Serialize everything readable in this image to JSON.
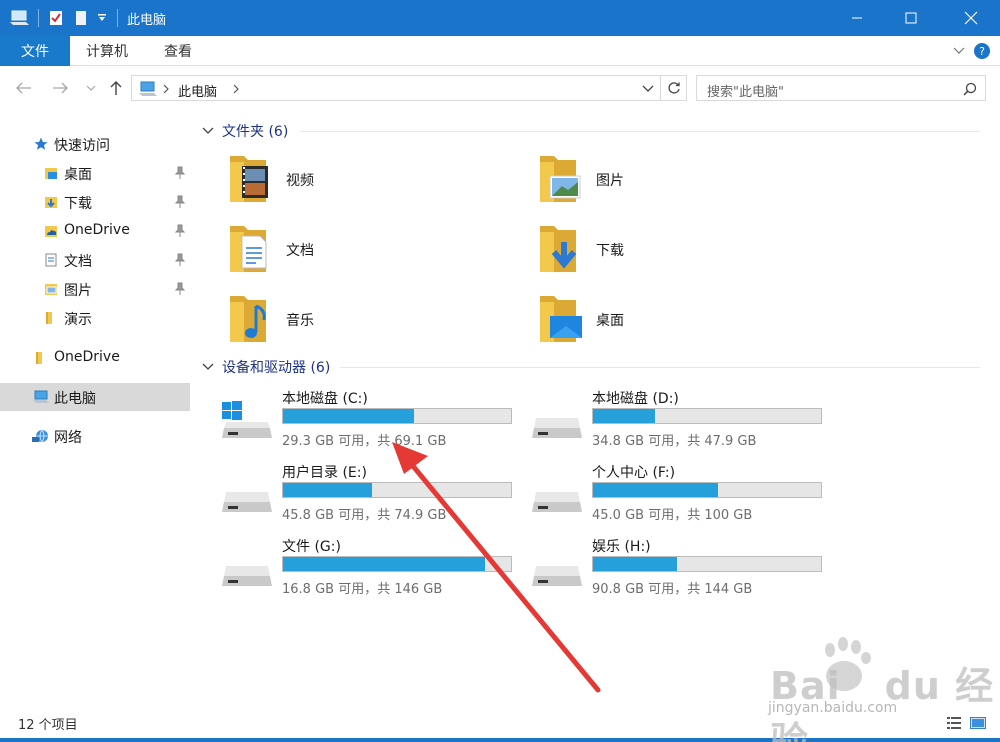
{
  "window": {
    "title": "此电脑"
  },
  "ribbon": {
    "tabs": [
      "文件",
      "计算机",
      "查看"
    ]
  },
  "address": {
    "location": "此电脑",
    "search_placeholder": "搜索\"此电脑\""
  },
  "sidebar": {
    "items": [
      {
        "label": "快速访问",
        "pinned": false,
        "icon": "star-icon"
      },
      {
        "label": "桌面",
        "pinned": true,
        "icon": "desktop-folder-icon"
      },
      {
        "label": "下载",
        "pinned": true,
        "icon": "download-folder-icon"
      },
      {
        "label": "OneDrive",
        "pinned": true,
        "icon": "onedrive-folder-icon"
      },
      {
        "label": "文档",
        "pinned": true,
        "icon": "documents-folder-icon"
      },
      {
        "label": "图片",
        "pinned": true,
        "icon": "pictures-folder-icon"
      },
      {
        "label": "演示",
        "pinned": false,
        "icon": "folder-icon"
      },
      {
        "label": "OneDrive",
        "pinned": false,
        "icon": "onedrive-icon"
      },
      {
        "label": "此电脑",
        "pinned": false,
        "icon": "computer-icon",
        "selected": true
      },
      {
        "label": "网络",
        "pinned": false,
        "icon": "network-icon"
      }
    ]
  },
  "folders": {
    "header": "文件夹 (6)",
    "items": [
      {
        "label": "视频",
        "icon": "videos-folder-icon"
      },
      {
        "label": "图片",
        "icon": "pictures-folder-icon"
      },
      {
        "label": "文档",
        "icon": "documents-folder-icon"
      },
      {
        "label": "下载",
        "icon": "downloads-folder-icon"
      },
      {
        "label": "音乐",
        "icon": "music-folder-icon"
      },
      {
        "label": "桌面",
        "icon": "desktop-folder-icon"
      }
    ]
  },
  "drives": {
    "header": "设备和驱动器 (6)",
    "items": [
      {
        "name": "本地磁盘 (C:)",
        "info": "29.3 GB 可用，共 69.1 GB",
        "used_fraction": 0.576,
        "system": true
      },
      {
        "name": "本地磁盘 (D:)",
        "info": "34.8 GB 可用，共 47.9 GB",
        "used_fraction": 0.274
      },
      {
        "name": "用户目录 (E:)",
        "info": "45.8 GB 可用，共 74.9 GB",
        "used_fraction": 0.389
      },
      {
        "name": "个人中心 (F:)",
        "info": "45.0 GB 可用，共 100 GB",
        "used_fraction": 0.55
      },
      {
        "name": "文件 (G:)",
        "info": "16.8 GB 可用，共 146 GB",
        "used_fraction": 0.885
      },
      {
        "name": "娱乐 (H:)",
        "info": "90.8 GB 可用，共 144 GB",
        "used_fraction": 0.37
      }
    ]
  },
  "status": {
    "item_count": "12 个项目"
  },
  "colors": {
    "accent": "#1a74ca",
    "bar_fill": "#26a0da",
    "section_header": "#1e3287",
    "folder": "#f2c94c",
    "arrow": "#e53935"
  }
}
